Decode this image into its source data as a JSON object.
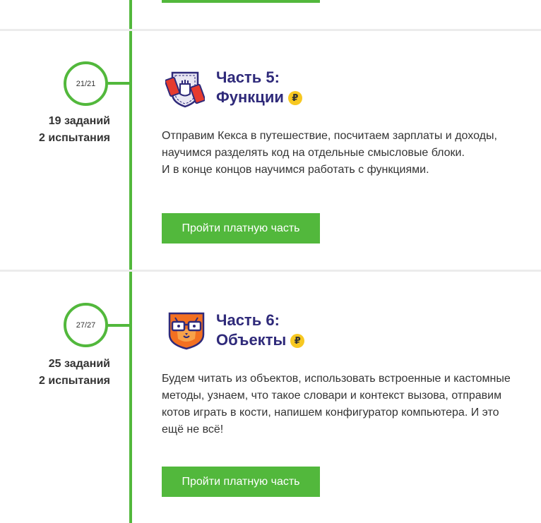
{
  "sections": [
    {
      "progress": "21/21",
      "tasks": "19 заданий",
      "tests": "2 испытания",
      "title_line1": "Часть 5:",
      "title_line2": "Функции",
      "paid_icon": "ruble-coin-icon",
      "description_lines": [
        "Отправим Кекса в путешествие, посчитаем зарплаты и доходы,",
        "научимся разделять код на отдельные смысловые блоки.",
        "И в конце концов научимся работать с функциями."
      ],
      "button_label": "Пройти платную часть",
      "icon": "fist-gear-shield-icon"
    },
    {
      "progress": "27/27",
      "tasks": "25 заданий",
      "tests": "2 испытания",
      "title_line1": "Часть 6:",
      "title_line2": "Объекты",
      "paid_icon": "ruble-coin-icon",
      "description_lines": [
        "Будем читать из объектов, использовать встроенные и кастомные",
        "методы, узнаем, что такое словари и контекст вызова, отправим",
        "котов играть в кости, напишем конфигуратор компьютера. И это",
        "ещё не всё!"
      ],
      "button_label": "Пройти платную часть",
      "icon": "cat-glasses-shield-icon"
    }
  ],
  "currency_symbol": "₽",
  "colors": {
    "accent_green": "#52b83c",
    "title_purple": "#2f2a7a",
    "coin_yellow": "#f7c821",
    "divider": "#ececec"
  }
}
